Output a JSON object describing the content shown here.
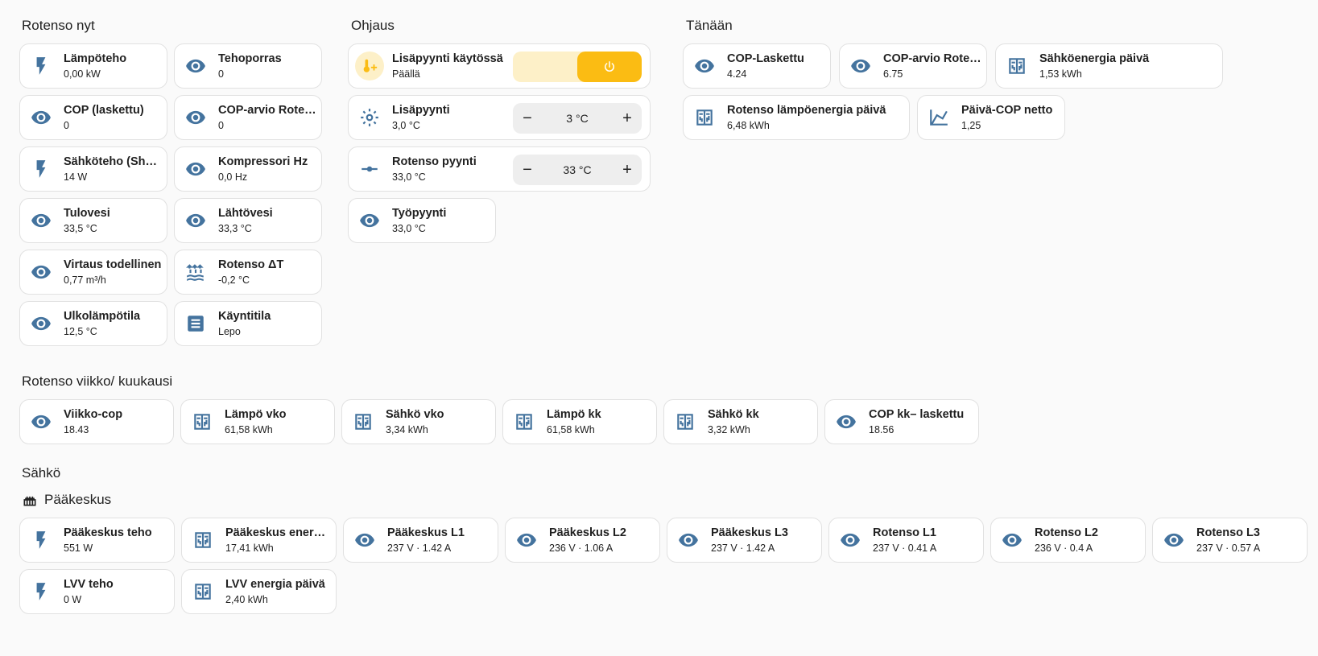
{
  "sections": {
    "nyt": "Rotenso nyt",
    "ohjaus": "Ohjaus",
    "tanaan": "Tänään",
    "viikko": "Rotenso viikko/ kuukausi",
    "sahko": "Sähkö",
    "paakeskus": "Pääkeskus"
  },
  "nyt": [
    {
      "name": "Lämpöteho",
      "state": "0,00 kW",
      "icon": "flash-icon"
    },
    {
      "name": "Tehoporras",
      "state": "0",
      "icon": "eye-icon"
    },
    {
      "name": "COP (laskettu)",
      "state": "0",
      "icon": "eye-icon"
    },
    {
      "name": "COP-arvio Rotenso",
      "state": "0",
      "icon": "eye-icon"
    },
    {
      "name": "Sähköteho (Shelly)",
      "state": "14 W",
      "icon": "flash-icon"
    },
    {
      "name": "Kompressori Hz",
      "state": "0,0 Hz",
      "icon": "eye-icon"
    },
    {
      "name": "Tulovesi",
      "state": "33,5 °C",
      "icon": "eye-icon"
    },
    {
      "name": "Lähtövesi",
      "state": "33,3 °C",
      "icon": "eye-icon"
    },
    {
      "name": "Virtaus todellinen",
      "state": "0,77 m³/h",
      "icon": "eye-icon"
    },
    {
      "name": "Rotenso ΔT",
      "state": "-0,2 °C",
      "icon": "water-flow-icon"
    },
    {
      "name": "Ulkolämpötila",
      "state": "12,5 °C",
      "icon": "eye-icon"
    },
    {
      "name": "Käyntitila",
      "state": "Lepo",
      "icon": "list-box-icon"
    }
  ],
  "ohjaus": {
    "switch": {
      "name": "Lisäpyynti käytössä",
      "state": "Päällä",
      "icon": "thermometer-plus-icon"
    },
    "lisapyynti": {
      "name": "Lisäpyynti",
      "state": "3,0 °C",
      "value": "3 °C",
      "icon": "sun-thermometer-icon"
    },
    "rotenso_pyynti": {
      "name": "Rotenso pyynti",
      "state": "33,0 °C",
      "value": "33 °C",
      "icon": "slider-icon"
    },
    "tyopyynti": {
      "name": "Työpyynti",
      "state": "33,0 °C",
      "icon": "eye-icon"
    },
    "minus": "−",
    "plus": "+"
  },
  "tanaan": [
    {
      "name": "COP-Laskettu",
      "state": "4.24",
      "icon": "eye-icon"
    },
    {
      "name": "COP-arvio Rotenso",
      "state": "6.75",
      "icon": "eye-icon"
    },
    {
      "name": "Sähköenergia päivä",
      "state": "1,53 kWh",
      "icon": "meter-icon"
    },
    {
      "name": "Rotenso lämpöenergia päivä",
      "state": "6,48 kWh",
      "icon": "meter-icon"
    },
    {
      "name": "Päivä-COP netto",
      "state": "1,25",
      "icon": "chart-line-icon"
    }
  ],
  "viikko": [
    {
      "name": "Viikko-cop",
      "state": "18.43",
      "icon": "eye-icon"
    },
    {
      "name": "Lämpö vko",
      "state": "61,58 kWh",
      "icon": "meter-icon"
    },
    {
      "name": "Sähkö vko",
      "state": "3,34 kWh",
      "icon": "meter-icon"
    },
    {
      "name": "Lämpö kk",
      "state": "61,58 kWh",
      "icon": "meter-icon"
    },
    {
      "name": "Sähkö kk",
      "state": "3,32 kWh",
      "icon": "meter-icon"
    },
    {
      "name": "COP kk– laskettu",
      "state": "18.56",
      "icon": "eye-icon"
    }
  ],
  "sahko": [
    {
      "name": "Pääkeskus teho",
      "state": "551 W",
      "icon": "flash-icon"
    },
    {
      "name": "Pääkeskus energia päivä",
      "state": "17,41 kWh",
      "icon": "meter-icon"
    },
    {
      "name": "Pääkeskus L1",
      "state": "237 V · 1.42 A",
      "icon": "eye-icon"
    },
    {
      "name": "Pääkeskus L2",
      "state": "236 V · 1.06 A",
      "icon": "eye-icon"
    },
    {
      "name": "Pääkeskus L3",
      "state": "237 V · 1.42 A",
      "icon": "eye-icon"
    },
    {
      "name": "Rotenso L1",
      "state": "237 V · 0.41 A",
      "icon": "eye-icon"
    },
    {
      "name": "Rotenso L2",
      "state": "236 V · 0.4 A",
      "icon": "eye-icon"
    },
    {
      "name": "Rotenso L3",
      "state": "237 V · 0.57 A",
      "icon": "eye-icon"
    },
    {
      "name": "LVV teho",
      "state": "0 W",
      "icon": "flash-icon"
    },
    {
      "name": "LVV energia päivä",
      "state": "2,40 kWh",
      "icon": "meter-icon"
    }
  ],
  "colors": {
    "icon": "#44739e",
    "accent": "#fbbc13",
    "card_border": "#e1e1e1",
    "background": "#fafafa"
  }
}
